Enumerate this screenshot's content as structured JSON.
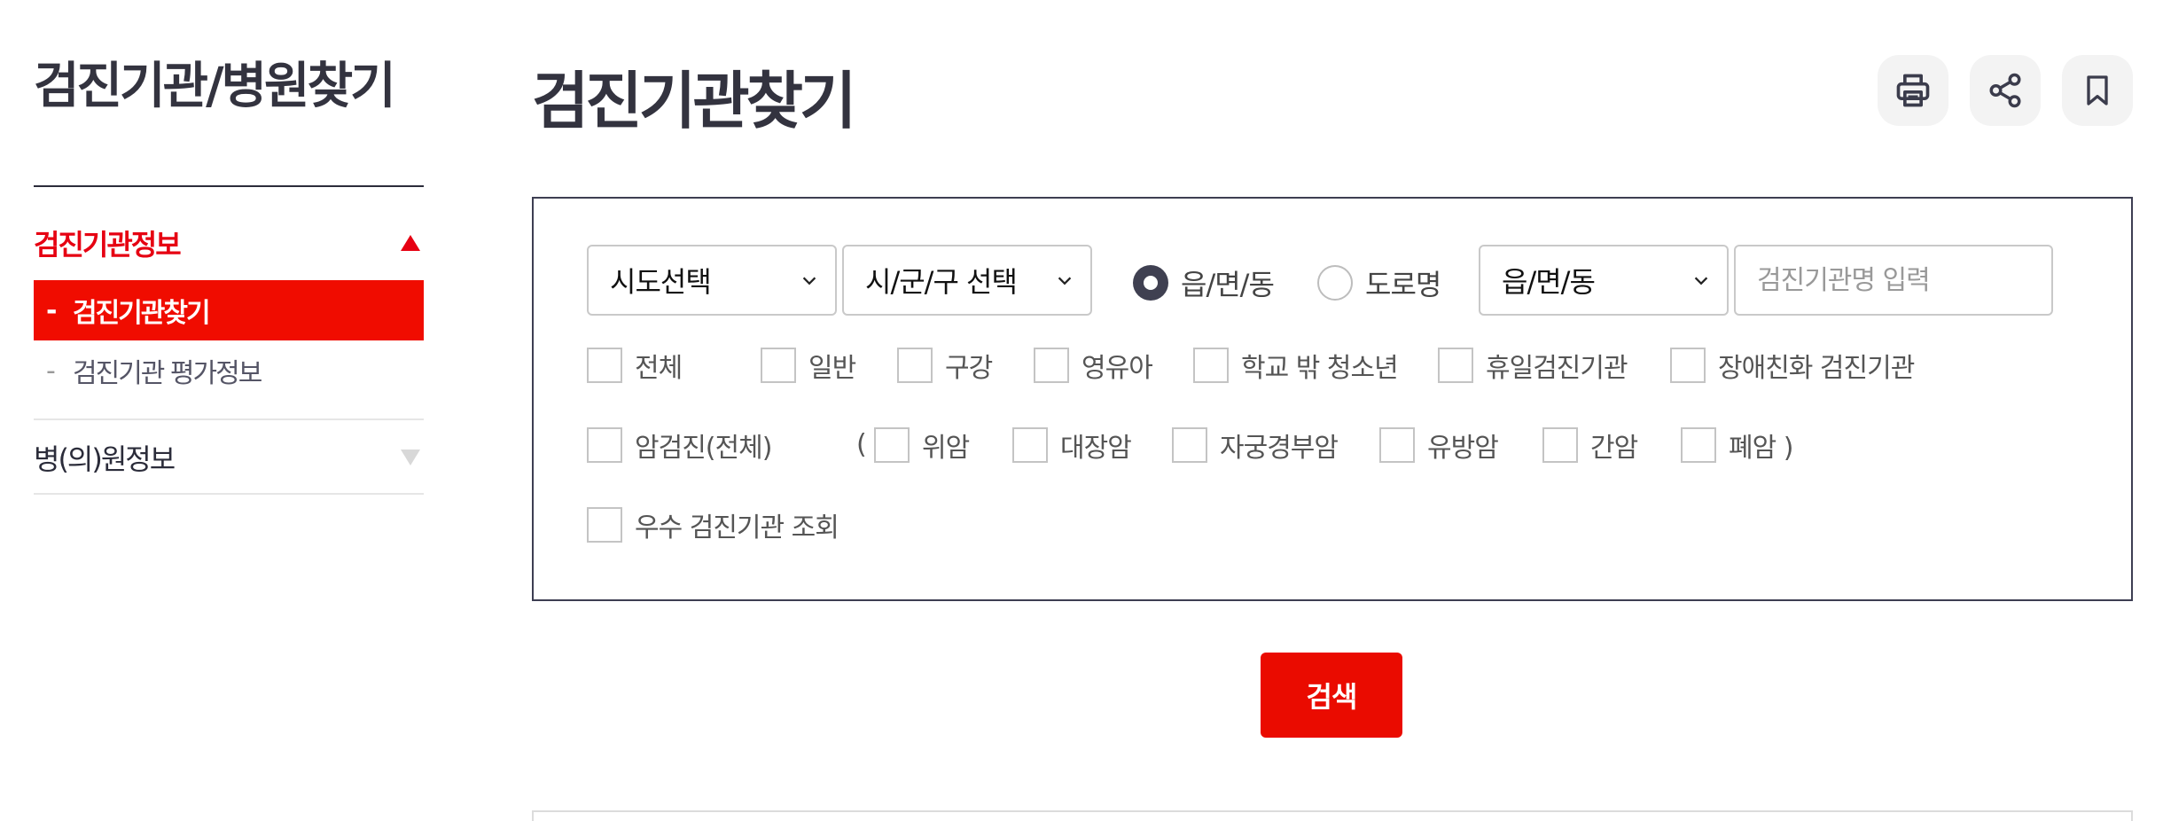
{
  "sidebar": {
    "title": "검진기관/병원찾기",
    "menus": [
      {
        "label": "검진기관정보",
        "expanded": true,
        "active": true
      },
      {
        "label": "병(의)원정보",
        "expanded": false,
        "active": false
      }
    ],
    "submenu": [
      {
        "dash": "-",
        "label": "검진기관찾기",
        "active": true
      },
      {
        "dash": "-",
        "label": "검진기관 평가정보",
        "active": false
      }
    ]
  },
  "header": {
    "title": "검진기관찾기",
    "tools": [
      {
        "icon": "print-icon"
      },
      {
        "icon": "share-icon"
      },
      {
        "icon": "bookmark-icon"
      }
    ]
  },
  "search": {
    "sido_select": "시도선택",
    "sigungu_select": "시/군/구 선택",
    "radios": [
      {
        "label": "읍/면/동",
        "checked": true
      },
      {
        "label": "도로명",
        "checked": false
      }
    ],
    "dong_select": "읍/면/동",
    "name_input": {
      "value": "",
      "placeholder": "검진기관명 입력"
    },
    "row1": [
      "전체",
      "일반",
      "구강",
      "영유아",
      "학교 밖 청소년",
      "휴일검진기관",
      "장애친화 검진기관"
    ],
    "row2_lead": "암검진(전체)",
    "paren_open": "(",
    "row2": [
      "위암",
      "대장암",
      "자궁경부암",
      "유방암",
      "간암",
      "폐암 )"
    ],
    "row3": [
      "우수 검진기관 조회"
    ],
    "button": "검색"
  },
  "colors": {
    "accent": "#e60012",
    "dark": "#2b2c3a",
    "radio_on": "#3f4051"
  }
}
